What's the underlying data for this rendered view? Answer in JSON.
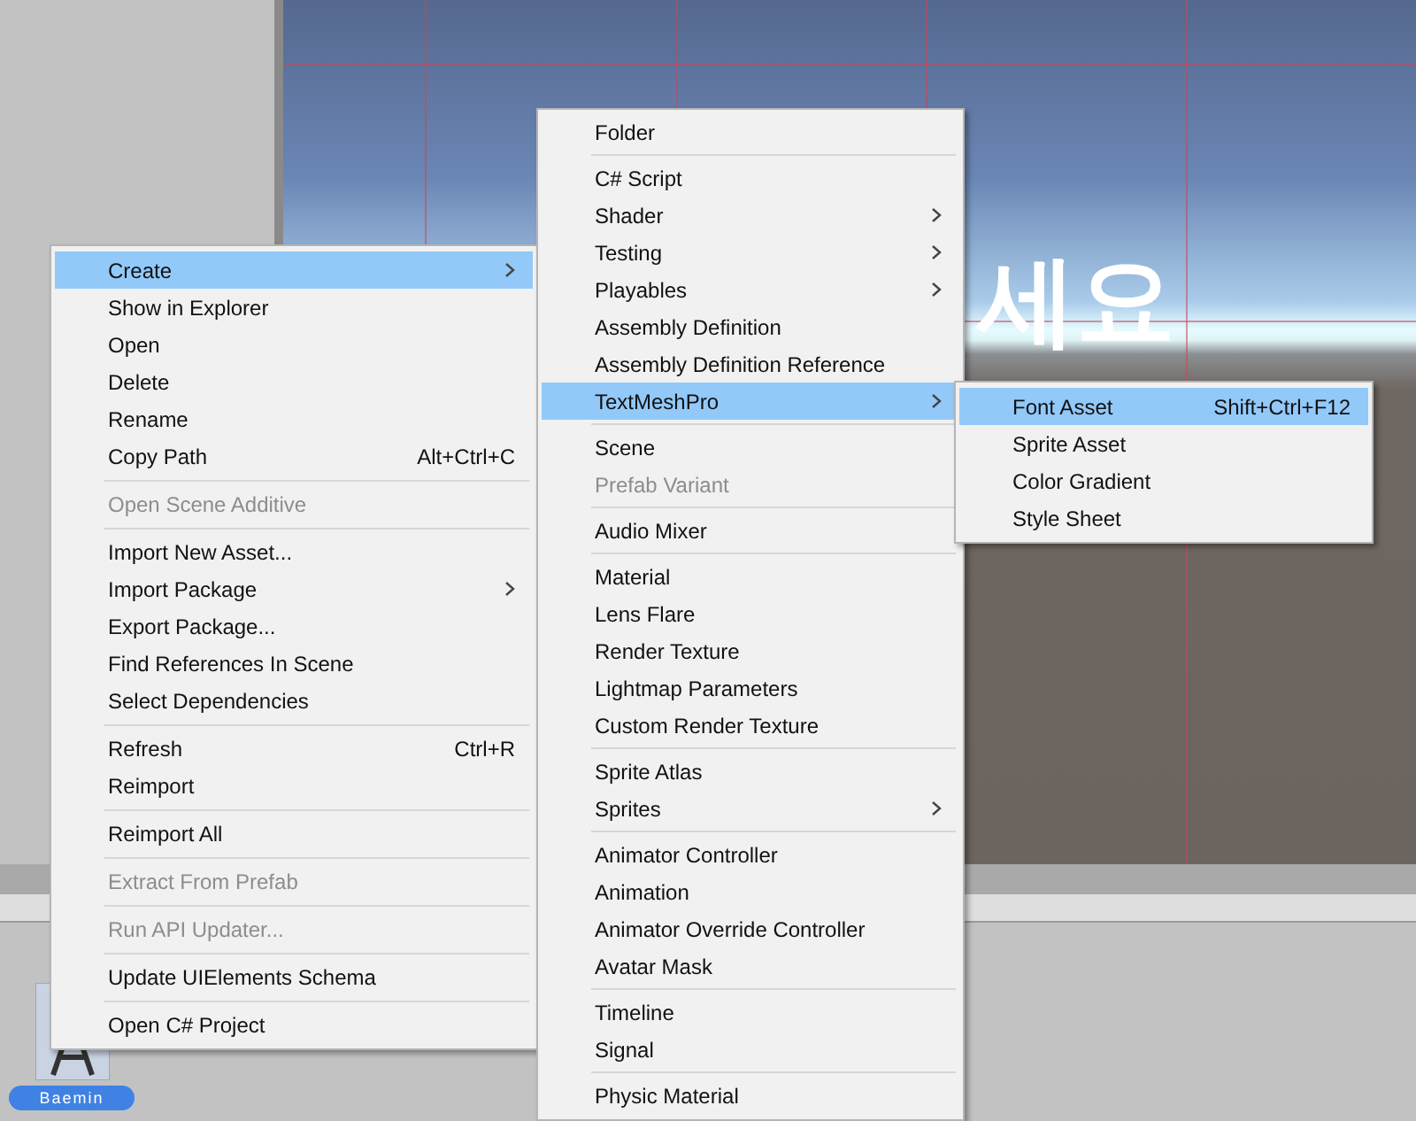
{
  "scene": {
    "text": "세요"
  },
  "asset": {
    "label": "Baemin"
  },
  "context_menu": [
    {
      "kind": "item",
      "label": "Create",
      "submenu": true,
      "selected": true
    },
    {
      "kind": "item",
      "label": "Show in Explorer",
      "selected": false
    },
    {
      "kind": "item",
      "label": "Open",
      "selected": false
    },
    {
      "kind": "item",
      "label": "Delete",
      "selected": false
    },
    {
      "kind": "item",
      "label": "Rename",
      "selected": false
    },
    {
      "kind": "item",
      "label": "Copy Path",
      "shortcut": "Alt+Ctrl+C",
      "selected": false
    },
    {
      "kind": "separator"
    },
    {
      "kind": "item",
      "label": "Open Scene Additive",
      "disabled": true,
      "selected": false
    },
    {
      "kind": "separator"
    },
    {
      "kind": "item",
      "label": "Import New Asset...",
      "selected": false
    },
    {
      "kind": "item",
      "label": "Import Package",
      "submenu": true,
      "selected": false
    },
    {
      "kind": "item",
      "label": "Export Package...",
      "selected": false
    },
    {
      "kind": "item",
      "label": "Find References In Scene",
      "selected": false
    },
    {
      "kind": "item",
      "label": "Select Dependencies",
      "selected": false
    },
    {
      "kind": "separator"
    },
    {
      "kind": "item",
      "label": "Refresh",
      "shortcut": "Ctrl+R",
      "selected": false
    },
    {
      "kind": "item",
      "label": "Reimport",
      "selected": false
    },
    {
      "kind": "separator"
    },
    {
      "kind": "item",
      "label": "Reimport All",
      "selected": false
    },
    {
      "kind": "separator"
    },
    {
      "kind": "item",
      "label": "Extract From Prefab",
      "disabled": true,
      "selected": false
    },
    {
      "kind": "separator"
    },
    {
      "kind": "item",
      "label": "Run API Updater...",
      "disabled": true,
      "selected": false
    },
    {
      "kind": "separator"
    },
    {
      "kind": "item",
      "label": "Update UIElements Schema",
      "selected": false
    },
    {
      "kind": "separator"
    },
    {
      "kind": "item",
      "label": "Open C# Project",
      "selected": false
    }
  ],
  "create_menu": [
    {
      "kind": "item",
      "label": "Folder",
      "selected": false
    },
    {
      "kind": "separator"
    },
    {
      "kind": "item",
      "label": "C# Script",
      "selected": false
    },
    {
      "kind": "item",
      "label": "Shader",
      "submenu": true,
      "selected": false
    },
    {
      "kind": "item",
      "label": "Testing",
      "submenu": true,
      "selected": false
    },
    {
      "kind": "item",
      "label": "Playables",
      "submenu": true,
      "selected": false
    },
    {
      "kind": "item",
      "label": "Assembly Definition",
      "selected": false
    },
    {
      "kind": "item",
      "label": "Assembly Definition Reference",
      "selected": false
    },
    {
      "kind": "item",
      "label": "TextMeshPro",
      "submenu": true,
      "selected": true
    },
    {
      "kind": "separator"
    },
    {
      "kind": "item",
      "label": "Scene",
      "selected": false
    },
    {
      "kind": "item",
      "label": "Prefab Variant",
      "disabled": true,
      "selected": false
    },
    {
      "kind": "separator"
    },
    {
      "kind": "item",
      "label": "Audio Mixer",
      "selected": false
    },
    {
      "kind": "separator"
    },
    {
      "kind": "item",
      "label": "Material",
      "selected": false
    },
    {
      "kind": "item",
      "label": "Lens Flare",
      "selected": false
    },
    {
      "kind": "item",
      "label": "Render Texture",
      "selected": false
    },
    {
      "kind": "item",
      "label": "Lightmap Parameters",
      "selected": false
    },
    {
      "kind": "item",
      "label": "Custom Render Texture",
      "selected": false
    },
    {
      "kind": "separator"
    },
    {
      "kind": "item",
      "label": "Sprite Atlas",
      "selected": false
    },
    {
      "kind": "item",
      "label": "Sprites",
      "submenu": true,
      "selected": false
    },
    {
      "kind": "separator"
    },
    {
      "kind": "item",
      "label": "Animator Controller",
      "selected": false
    },
    {
      "kind": "item",
      "label": "Animation",
      "selected": false
    },
    {
      "kind": "item",
      "label": "Animator Override Controller",
      "selected": false
    },
    {
      "kind": "item",
      "label": "Avatar Mask",
      "selected": false
    },
    {
      "kind": "separator"
    },
    {
      "kind": "item",
      "label": "Timeline",
      "selected": false
    },
    {
      "kind": "item",
      "label": "Signal",
      "selected": false
    },
    {
      "kind": "separator"
    },
    {
      "kind": "item",
      "label": "Physic Material",
      "selected": false
    }
  ],
  "textmeshpro_menu": [
    {
      "kind": "item",
      "label": "Font Asset",
      "shortcut": "Shift+Ctrl+F12",
      "selected": true
    },
    {
      "kind": "item",
      "label": "Sprite Asset",
      "selected": false
    },
    {
      "kind": "item",
      "label": "Color Gradient",
      "selected": false
    },
    {
      "kind": "item",
      "label": "Style Sheet",
      "selected": false
    }
  ]
}
